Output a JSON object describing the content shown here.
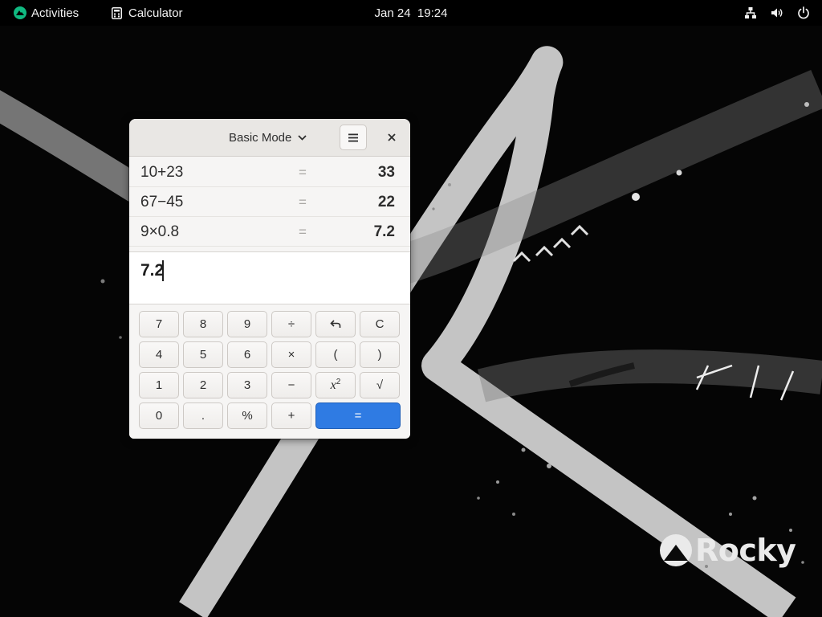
{
  "topbar": {
    "activities_label": "Activities",
    "app_name": "Calculator",
    "clock": "Jan 24  19:24"
  },
  "wallpaper": {
    "brand_name": "Rocky"
  },
  "calculator": {
    "mode_label": "Basic Mode",
    "history": [
      {
        "expression": "10+23",
        "equals": "=",
        "result": "33"
      },
      {
        "expression": "67−45",
        "equals": "=",
        "result": "22"
      },
      {
        "expression": "9×0.8",
        "equals": "=",
        "result": "7.2"
      }
    ],
    "display": "7.2",
    "keys": {
      "k7": "7",
      "k8": "8",
      "k9": "9",
      "divide": "÷",
      "clear": "C",
      "k4": "4",
      "k5": "5",
      "k6": "6",
      "multiply": "×",
      "open_paren": "(",
      "close_paren": ")",
      "k1": "1",
      "k2": "2",
      "k3": "3",
      "subtract": "−",
      "square_base": "x",
      "square_exp": "2",
      "sqrt": "√",
      "k0": "0",
      "point": ".",
      "percent": "%",
      "add": "+",
      "equals": "="
    }
  },
  "colors": {
    "accent": "#2f7be3",
    "topbar": "#000000",
    "window_bg": "#f6f5f4"
  }
}
